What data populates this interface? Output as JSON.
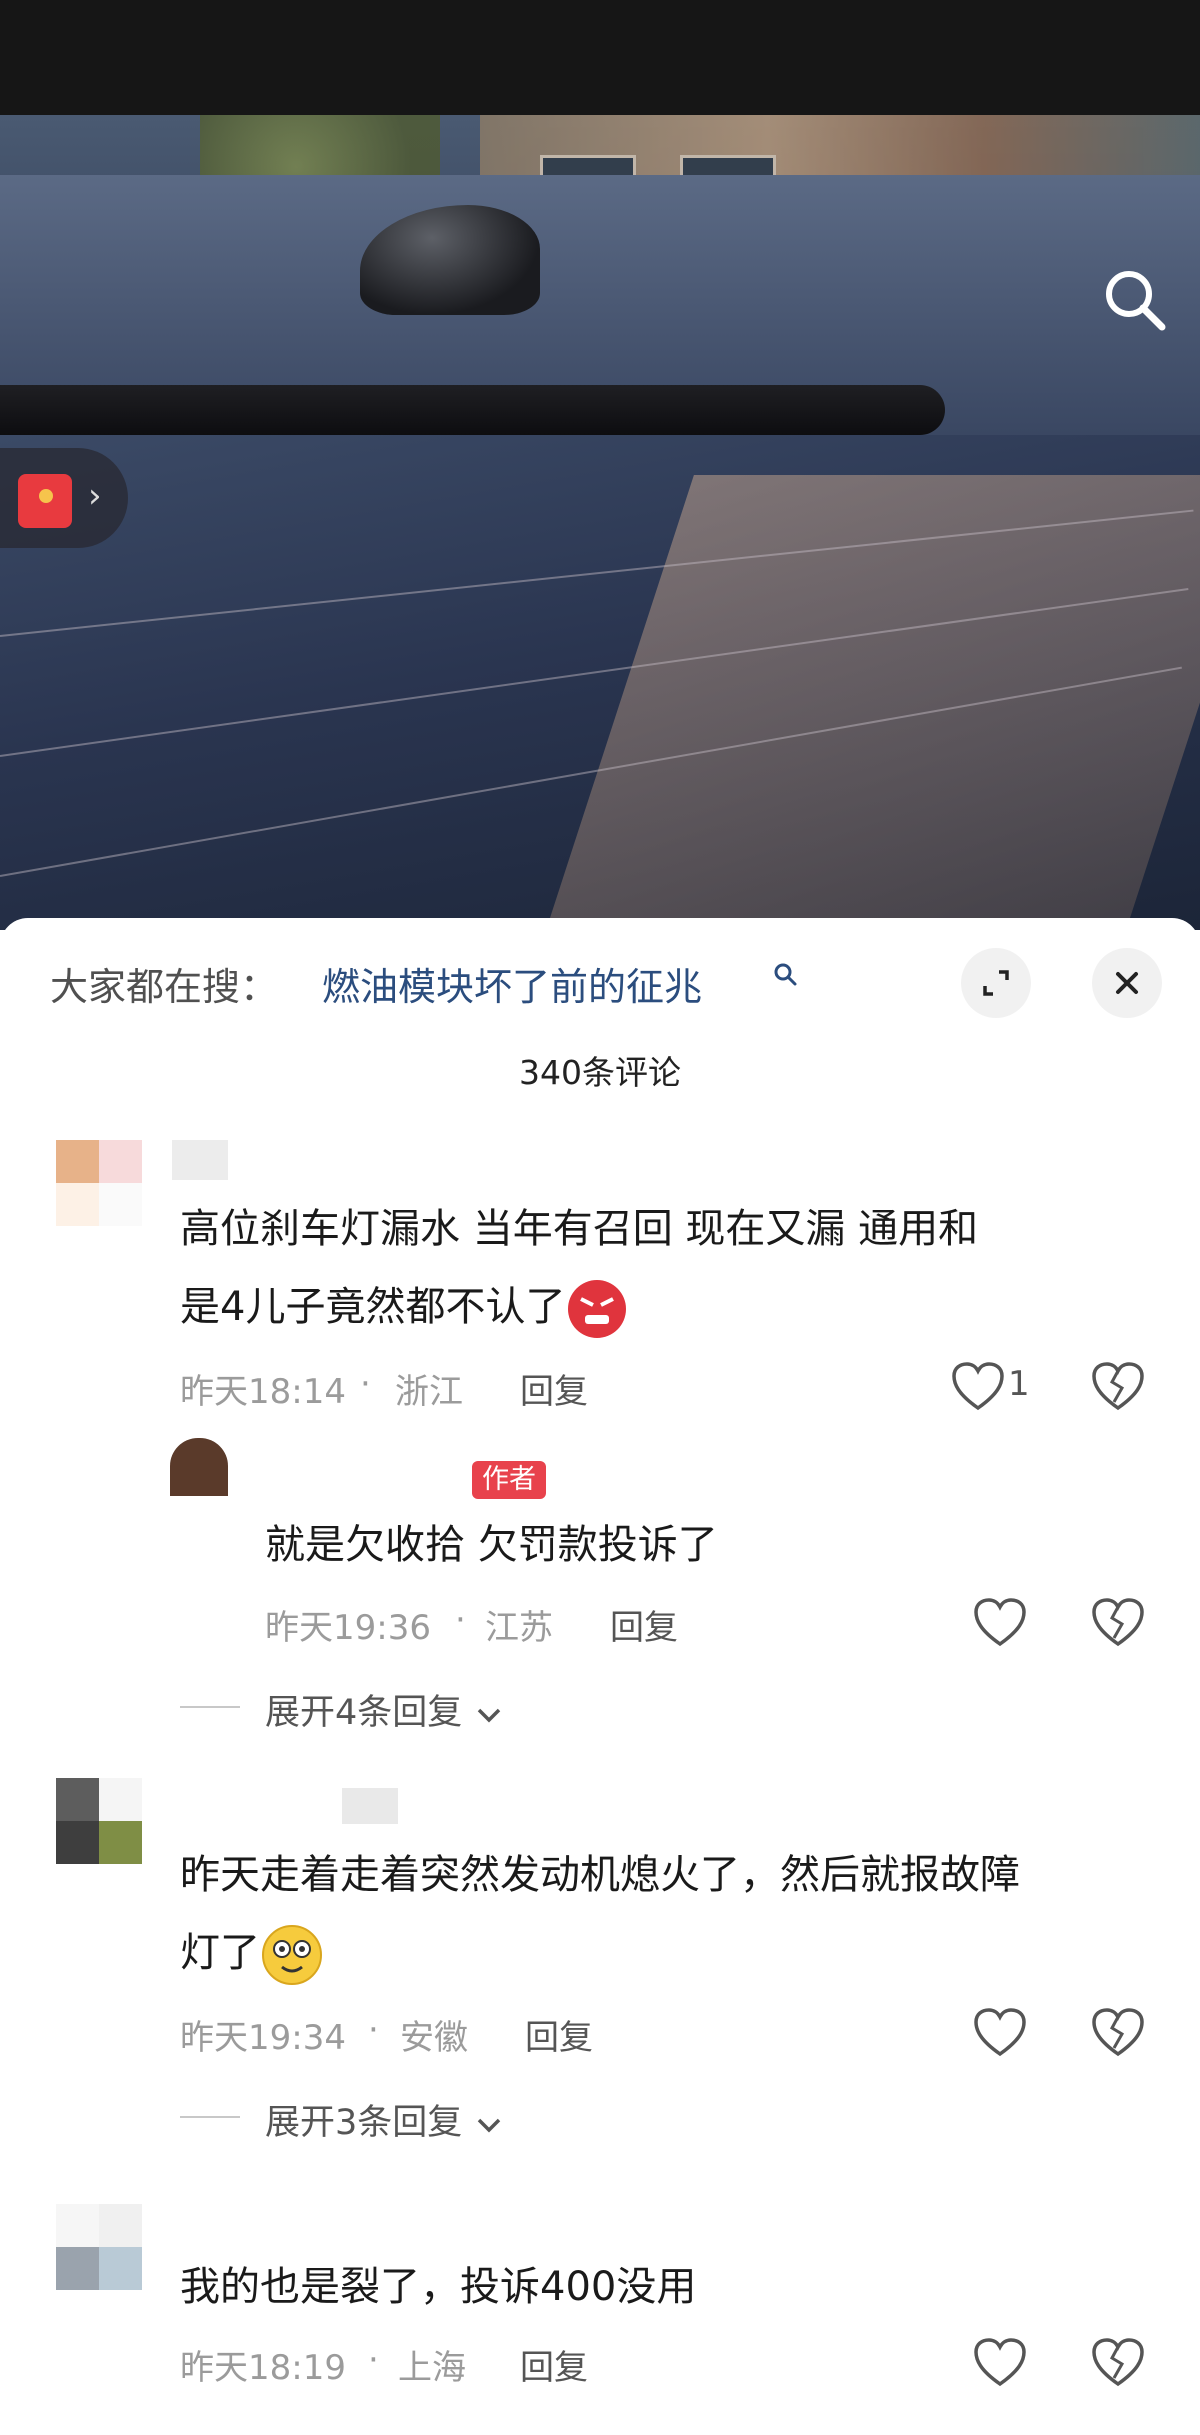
{
  "hot_search": {
    "prefix": "大家都在搜：",
    "keyword": "燃油模块坏了前的征兆"
  },
  "comment_count": "340条评论",
  "comments": [
    {
      "text_line1": "高位刹车灯漏水  当年有召回  现在又漏  通用和",
      "text_line2": "是4儿子竟然都不认了",
      "emoji": "angry-emoji",
      "time": "昨天18:14",
      "location": "浙江",
      "reply_label": "回复",
      "likes": "1"
    },
    {
      "badge": "作者",
      "text": "就是欠收拾 欠罚款投诉了",
      "time": "昨天19:36",
      "location": "江苏",
      "reply_label": "回复",
      "expand": "展开4条回复"
    },
    {
      "text_line1": "昨天走着走着突然发动机熄火了，然后就报故障",
      "text_line2": "灯了",
      "emoji": "dizzy-emoji",
      "time": "昨天19:34",
      "location": "安徽",
      "reply_label": "回复",
      "expand": "展开3条回复"
    },
    {
      "text": "我的也是裂了，投诉400没用",
      "time": "昨天18:19",
      "location": "上海",
      "reply_label": "回复"
    }
  ],
  "meta_separator": "·",
  "colors": {
    "author_badge": "#e8424c",
    "keyword": "#2b4d7e",
    "muted": "#9b9b9b"
  }
}
